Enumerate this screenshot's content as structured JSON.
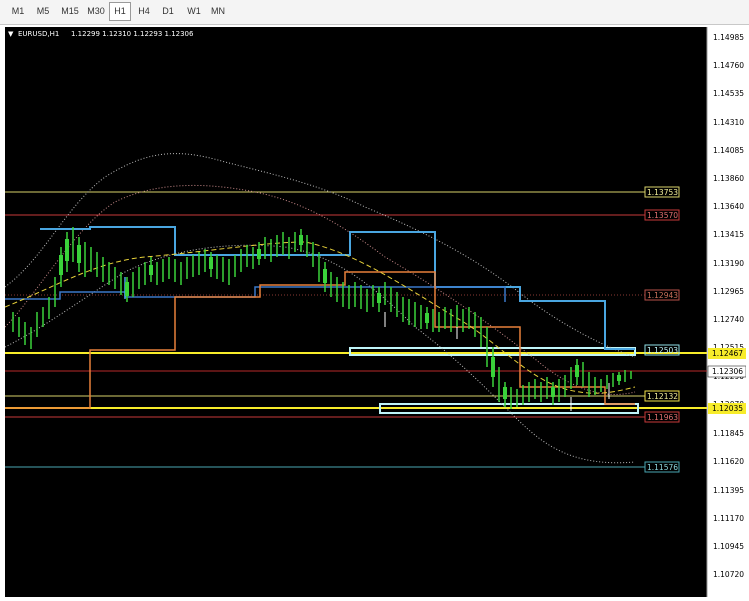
{
  "toolbar": {
    "timeframes": [
      "M1",
      "M5",
      "M15",
      "M30",
      "H1",
      "H4",
      "D1",
      "W1",
      "MN"
    ],
    "active": "H1"
  },
  "chart": {
    "symbol_label": "EURUSD,H1",
    "ohlc_label": "1.12299 1.12310 1.12293 1.12306",
    "price_scale": [
      "1.14985",
      "1.14760",
      "1.14535",
      "1.14310",
      "1.14085",
      "1.13860",
      "1.13640",
      "1.13415",
      "1.13190",
      "1.12965",
      "1.12740",
      "1.12515",
      "1.12290",
      "1.12070",
      "1.11845",
      "1.11620",
      "1.11395",
      "1.11170",
      "1.10945",
      "1.10720"
    ],
    "levels": [
      {
        "label": "1.13753",
        "color": "#d8d26a",
        "text_color": "#f2ee9a"
      },
      {
        "label": "1.13570",
        "color": "#c83a3a",
        "text_color": "#e07070"
      },
      {
        "label": "1.12943",
        "color": "#b8524a",
        "text_color": "#c8705a"
      },
      {
        "label": "1.12503",
        "color": "#8fe0e8",
        "text_color": "#bff4f8"
      },
      {
        "label": "1.12132",
        "color": "#f2e24a",
        "text_color": "#f2ee9a"
      },
      {
        "label": "1.11963",
        "color": "#c83a3a",
        "text_color": "#e07070"
      },
      {
        "label": "1.11576",
        "color": "#4aa6b2",
        "text_color": "#8fd6de"
      }
    ],
    "right_tags": [
      {
        "label": "1.12467",
        "bg": "#f7ec2a",
        "fg": "#000000"
      },
      {
        "label": "1.12306",
        "bg": "#ffffff",
        "fg": "#000000"
      },
      {
        "label": "1.12035",
        "bg": "#f7ec2a",
        "fg": "#000000"
      }
    ]
  }
}
